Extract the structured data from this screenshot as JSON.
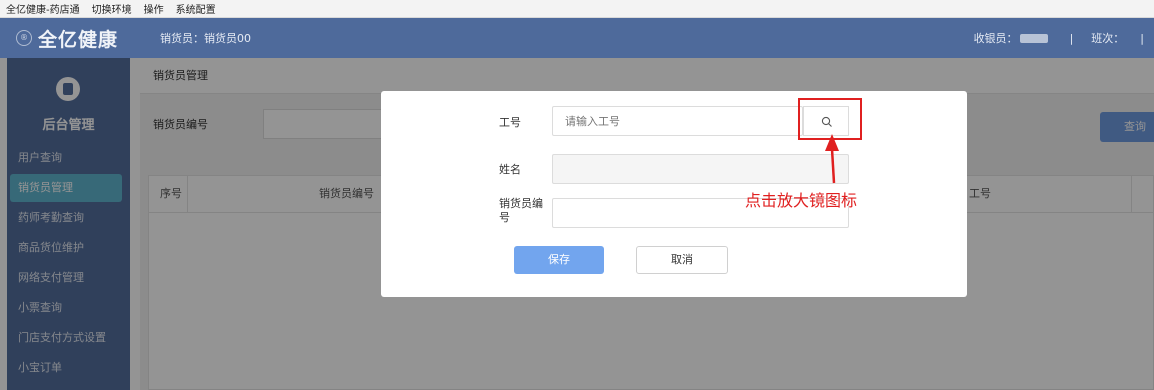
{
  "menubar": {
    "items": [
      "全亿健康-药店通",
      "切换环境",
      "操作",
      "系统配置"
    ]
  },
  "header": {
    "logo_glyph": "®",
    "brand": "全亿健康",
    "salesman": "销货员：销货员00",
    "cashier_label": "收银员：",
    "sep": "|",
    "shift_label": "班次：",
    "end_sep": "|"
  },
  "sidebar": {
    "title": "后台管理",
    "items": [
      {
        "label": "用户查询"
      },
      {
        "label": "销货员管理",
        "active": true
      },
      {
        "label": "药师考勤查询"
      },
      {
        "label": "商品货位维护"
      },
      {
        "label": "网络支付管理"
      },
      {
        "label": "小票查询"
      },
      {
        "label": "门店支付方式设置"
      },
      {
        "label": "小宝订单"
      }
    ]
  },
  "main": {
    "breadcrumb": "销货员管理",
    "filter_label": "销货员编号",
    "query_button": "查询",
    "table": {
      "columns": [
        "序号",
        "销货员编号",
        "工号"
      ]
    }
  },
  "dialog": {
    "fields": {
      "job_no": {
        "label": "工号",
        "placeholder": "请输入工号"
      },
      "name": {
        "label": "姓名"
      },
      "salesman_no": {
        "label": "销货员编号"
      }
    },
    "save_label": "保存",
    "cancel_label": "取消"
  },
  "annotation": {
    "text": "点击放大镜图标",
    "color": "#e02020"
  },
  "colors": {
    "topbar": "#4e6a9b",
    "sidebar": "#546e9d",
    "active_item": "#5fb5cf",
    "primary_button": "#72a5ee"
  }
}
